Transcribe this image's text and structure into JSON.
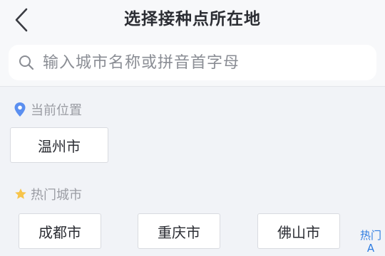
{
  "header": {
    "title": "选择接种点所在地",
    "back_icon": "chevron-left-icon"
  },
  "search": {
    "placeholder": "输入城市名称或拼音首字母",
    "value": "",
    "icon": "search-icon"
  },
  "current_location": {
    "label": "当前位置",
    "icon": "location-pin-icon",
    "icon_color": "#5b8ff0",
    "city": "温州市"
  },
  "hot_cities": {
    "label": "热门城市",
    "icon": "star-icon",
    "icon_color": "#f7c44a",
    "cities": [
      "成都市",
      "重庆市",
      "佛山市"
    ]
  },
  "index_bar": {
    "items": [
      "热门",
      "A"
    ],
    "color": "#2f7de1"
  }
}
